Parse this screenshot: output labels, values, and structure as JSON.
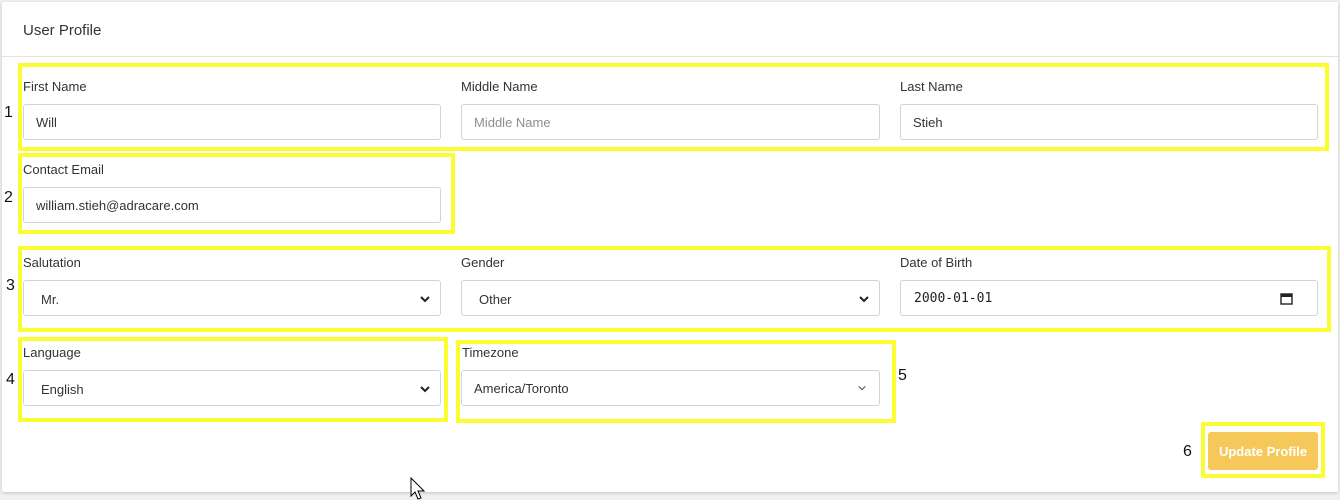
{
  "card": {
    "title": "User Profile"
  },
  "annotations": [
    "1",
    "2",
    "3",
    "4",
    "5",
    "6"
  ],
  "fields": {
    "first_name": {
      "label": "First Name",
      "value": "Will"
    },
    "middle_name": {
      "label": "Middle Name",
      "value": "",
      "placeholder": "Middle Name"
    },
    "last_name": {
      "label": "Last Name",
      "value": "Stieh"
    },
    "contact_email": {
      "label": "Contact Email",
      "value": "william.stieh@adracare.com"
    },
    "salutation": {
      "label": "Salutation",
      "value": "Mr."
    },
    "gender": {
      "label": "Gender",
      "value": "Other"
    },
    "date_of_birth": {
      "label": "Date of Birth",
      "value": "2000-01-01"
    },
    "language": {
      "label": "Language",
      "value": "English"
    },
    "timezone": {
      "label": "Timezone",
      "value": "America/Toronto"
    }
  },
  "actions": {
    "update_label": "Update Profile"
  },
  "colors": {
    "highlight": "#fcfc32",
    "button": "#f6c85a",
    "field_border": "#cfd4da"
  },
  "icons": {
    "select_arrow": "chevron-down-icon",
    "date_picker": "calendar-icon",
    "pointer": "mouse-cursor-icon"
  }
}
